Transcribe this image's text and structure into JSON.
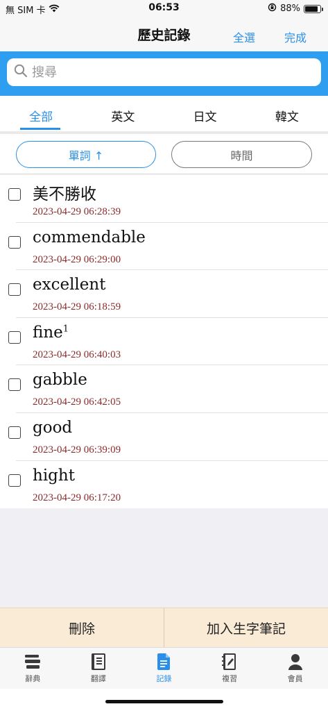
{
  "status": {
    "carrier": "無 SIM 卡",
    "time": "06:53",
    "battery_text": "88%",
    "battery_level": 0.88
  },
  "nav": {
    "title": "歷史記錄",
    "select_all": "全選",
    "done": "完成"
  },
  "search": {
    "placeholder": "搜尋"
  },
  "tabs": [
    {
      "label": "全部",
      "active": true
    },
    {
      "label": "英文",
      "active": false
    },
    {
      "label": "日文",
      "active": false
    },
    {
      "label": "韓文",
      "active": false
    }
  ],
  "sort": {
    "word_label": "單詞 ↑",
    "time_label": "時間"
  },
  "items": [
    {
      "word": "美不勝收",
      "sup": "",
      "time": "2023-04-29 06:28:39"
    },
    {
      "word": "commendable",
      "sup": "",
      "time": "2023-04-29 06:29:00"
    },
    {
      "word": "excellent",
      "sup": "",
      "time": "2023-04-29 06:18:59"
    },
    {
      "word": "fine",
      "sup": "1",
      "time": "2023-04-29 06:40:03"
    },
    {
      "word": "gabble",
      "sup": "",
      "time": "2023-04-29 06:42:05"
    },
    {
      "word": "good",
      "sup": "",
      "time": "2023-04-29 06:39:09"
    },
    {
      "word": "hight",
      "sup": "",
      "time": "2023-04-29 06:17:20"
    }
  ],
  "actions": {
    "delete": "刪除",
    "add_to_notebook": "加入生字筆記"
  },
  "tabbar": [
    {
      "label": "辭典",
      "icon": "dictionary-icon",
      "active": false
    },
    {
      "label": "翻譯",
      "icon": "translate-icon",
      "active": false
    },
    {
      "label": "記錄",
      "icon": "history-icon",
      "active": true
    },
    {
      "label": "複習",
      "icon": "review-icon",
      "active": false
    },
    {
      "label": "會員",
      "icon": "member-icon",
      "active": false
    }
  ],
  "colors": {
    "accent": "#2a8fe8",
    "search_band": "#2e9ff0",
    "timestamp": "#8b2a2a",
    "action_bar": "#faebd7"
  }
}
